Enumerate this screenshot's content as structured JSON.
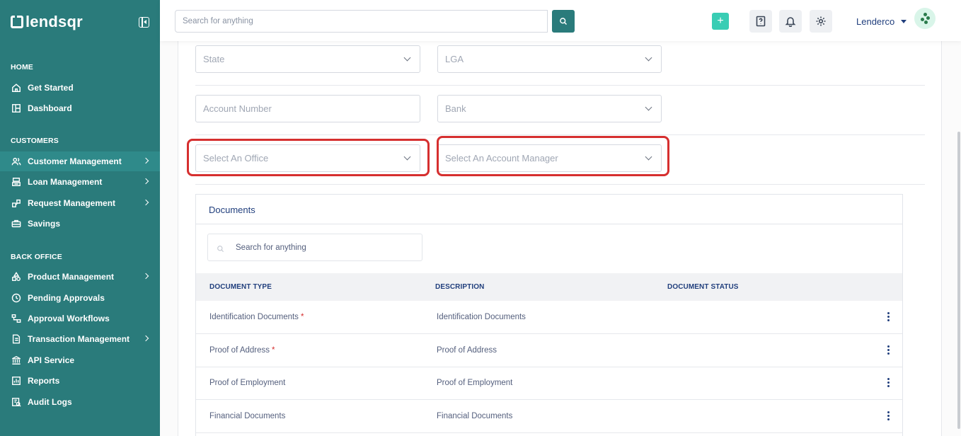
{
  "brand": {
    "name": "lendsqr"
  },
  "sidebar": {
    "sections": [
      {
        "title": "HOME"
      },
      {
        "title": "CUSTOMERS"
      },
      {
        "title": "BACK OFFICE"
      }
    ],
    "items": [
      {
        "label": "Get Started",
        "icon": "home-icon"
      },
      {
        "label": "Dashboard",
        "icon": "dashboard-icon"
      },
      {
        "label": "Customer Management",
        "icon": "users-icon",
        "active": true,
        "has_submenu": true
      },
      {
        "label": "Loan Management",
        "icon": "loan-icon",
        "has_submenu": true
      },
      {
        "label": "Request Management",
        "icon": "request-icon",
        "has_submenu": true
      },
      {
        "label": "Savings",
        "icon": "savings-icon"
      },
      {
        "label": "Product Management",
        "icon": "product-icon",
        "has_submenu": true
      },
      {
        "label": "Pending Approvals",
        "icon": "clock-icon"
      },
      {
        "label": "Approval Workflows",
        "icon": "workflow-icon"
      },
      {
        "label": "Transaction Management",
        "icon": "transaction-icon",
        "has_submenu": true
      },
      {
        "label": "API Service",
        "icon": "bank-icon"
      },
      {
        "label": "Reports",
        "icon": "report-icon"
      },
      {
        "label": "Audit Logs",
        "icon": "audit-icon"
      }
    ]
  },
  "topbar": {
    "search_placeholder": "Search for anything",
    "plus_label": "+",
    "user_name": "Lenderco"
  },
  "form": {
    "state_placeholder": "State",
    "lga_placeholder": "LGA",
    "account_number_placeholder": "Account Number",
    "bank_placeholder": "Bank",
    "office_placeholder": "Select An Office",
    "account_manager_placeholder": "Select An Account Manager"
  },
  "documents": {
    "title": "Documents",
    "search_placeholder": "Search for anything",
    "columns": [
      "DOCUMENT TYPE",
      "DESCRIPTION",
      "DOCUMENT STATUS"
    ],
    "rows": [
      {
        "type": "Identification Documents",
        "required": true,
        "description": "Identification Documents"
      },
      {
        "type": "Proof of Address",
        "required": true,
        "description": "Proof of Address"
      },
      {
        "type": "Proof of Employment",
        "required": false,
        "description": "Proof of Employment"
      },
      {
        "type": "Financial Documents",
        "required": false,
        "description": "Financial Documents"
      }
    ],
    "required_marker": "*"
  },
  "colors": {
    "sidebar_bg": "#2a7b7b",
    "accent": "#39cdb4",
    "primary_text": "#213f7d",
    "highlight": "#d62f2f"
  }
}
